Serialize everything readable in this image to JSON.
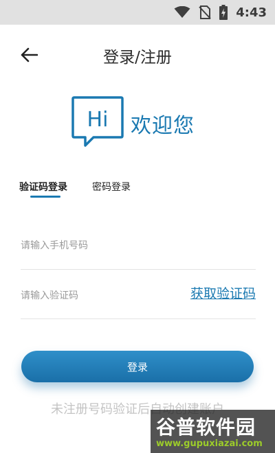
{
  "status_bar": {
    "time": "4:43",
    "icons": [
      "wifi-icon",
      "no-sim-icon",
      "battery-charging-icon"
    ]
  },
  "header": {
    "back_icon": "arrow-left-icon",
    "title": "登录/注册"
  },
  "welcome": {
    "bubble_text": "Hi",
    "text": "欢迎您",
    "color": "#1a79b1"
  },
  "tabs": [
    {
      "label": "验证码登录",
      "active": true
    },
    {
      "label": "密码登录",
      "active": false
    }
  ],
  "form": {
    "phone_placeholder": "请输入手机号码",
    "code_placeholder": "请输入验证码",
    "get_code_label": "获取验证码"
  },
  "login_button_label": "登录",
  "hint": "未注册号码验证后自动创建账户",
  "watermark": {
    "logo": "谷普软件园",
    "url": "www.gupuxiazai.com"
  }
}
